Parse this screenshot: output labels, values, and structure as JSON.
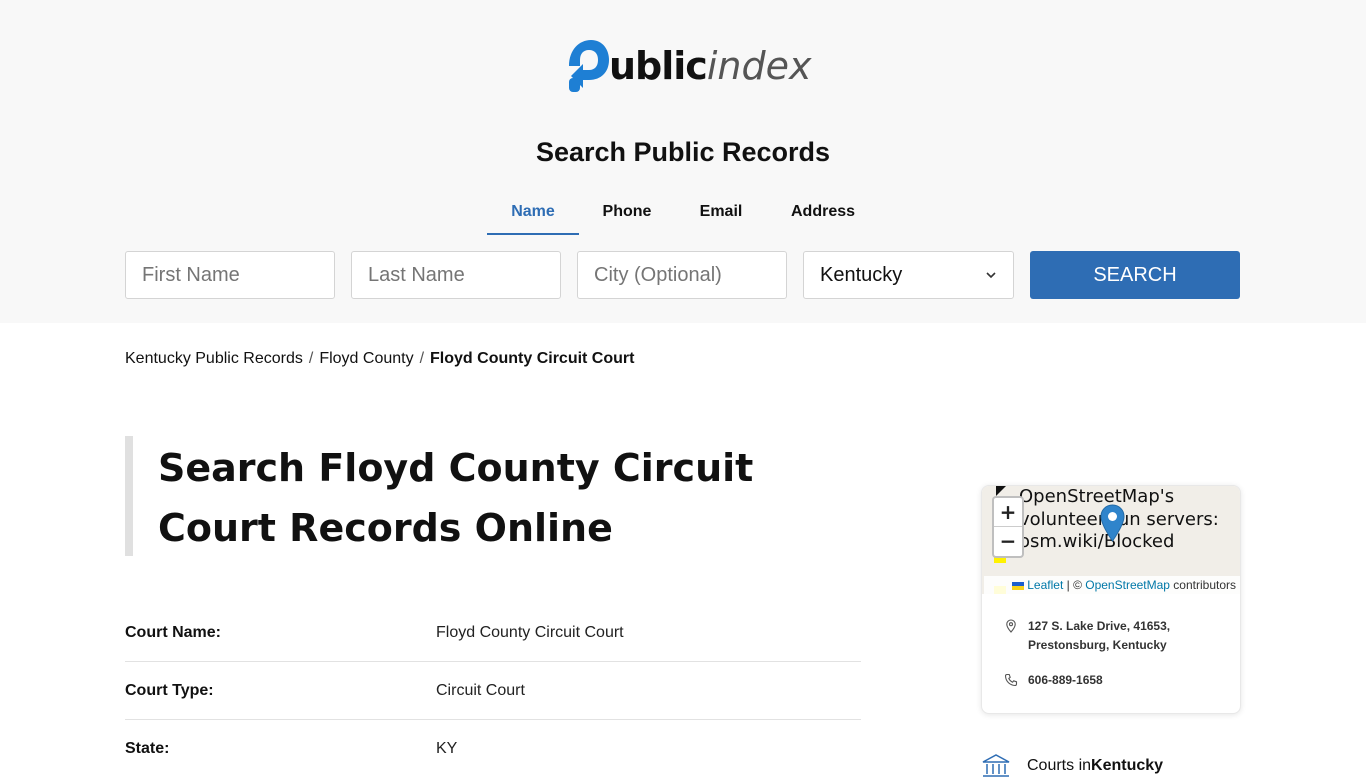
{
  "logo": {
    "bold": "ublic",
    "light": "index"
  },
  "search": {
    "title": "Search Public Records",
    "tabs": [
      {
        "label": "Name",
        "active": true
      },
      {
        "label": "Phone",
        "active": false
      },
      {
        "label": "Email",
        "active": false
      },
      {
        "label": "Address",
        "active": false
      }
    ],
    "first_name_placeholder": "First Name",
    "last_name_placeholder": "Last Name",
    "city_placeholder": "City (Optional)",
    "state_selected": "Kentucky",
    "button_label": "SEARCH"
  },
  "breadcrumb": {
    "items": [
      "Kentucky Public Records",
      "Floyd County"
    ],
    "separator": "/",
    "current": "Floyd County Circuit Court"
  },
  "page": {
    "heading_line1": "Search Floyd County Circuit",
    "heading_line2": "Court Records Online"
  },
  "info": [
    {
      "label": "Court Name:",
      "value": "Floyd County Circuit Court"
    },
    {
      "label": "Court Type:",
      "value": "Circuit Court"
    },
    {
      "label": "State:",
      "value": "KY"
    }
  ],
  "map": {
    "message": "OpenStreetMap's\nvolunteer-run servers:\nosm.wiki/Blocked",
    "zoom_in": "+",
    "zoom_out": "−",
    "attribution_leaflet": "Leaflet",
    "attribution_sep": " | © ",
    "attribution_osm": "OpenStreetMap",
    "attribution_suffix": " contributors"
  },
  "card": {
    "address_line1": "127 S. Lake Drive, 41653,",
    "address_line2": "Prestonsburg, Kentucky",
    "phone": "606-889-1658"
  },
  "courts": {
    "prefix": "Courts in ",
    "state": "Kentucky"
  },
  "colors": {
    "accent": "#2e6db4",
    "header_bg": "#f8f8f8",
    "marker": "#2f84cb"
  }
}
